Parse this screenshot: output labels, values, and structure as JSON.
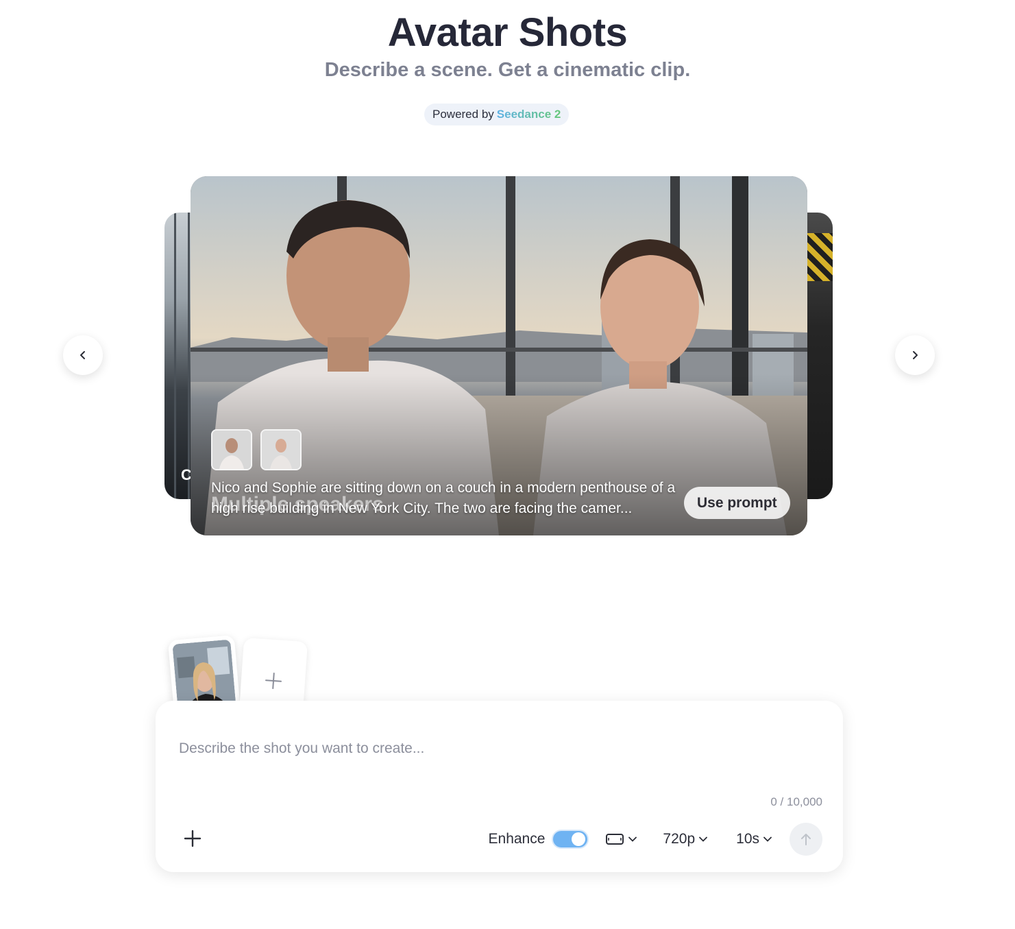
{
  "header": {
    "title": "Avatar Shots",
    "subtitle": "Describe a scene. Get a cinematic clip.",
    "powered_prefix": "Powered by",
    "powered_brand": "Seedance 2"
  },
  "carousel": {
    "prev_icon": "chevron-left-icon",
    "next_icon": "chevron-right-icon",
    "left_card_letter": "C",
    "active_card": {
      "caption": "Nico and Sophie are sitting down on a couch in a modern penthouse of a high rise building in New York City. The two are facing the camer...",
      "label": "Multiple speakers",
      "use_prompt_label": "Use prompt",
      "speakers": [
        "Nico",
        "Sophie"
      ]
    }
  },
  "composer": {
    "add_reference_icon": "plus-icon",
    "placeholder": "Describe the shot you want to create...",
    "counter": "0 / 10,000",
    "enhance_label": "Enhance",
    "enhance_on": true,
    "aspect_icon": "landscape-aspect-icon",
    "resolution": "720p",
    "duration": "10s",
    "send_icon": "arrow-up-icon"
  },
  "colors": {
    "title": "#262838",
    "subtitle": "#7d8191",
    "brand_gradient_start": "#5fb2e6",
    "brand_gradient_end": "#65c778",
    "toggle_on": "#6fb3f2"
  }
}
